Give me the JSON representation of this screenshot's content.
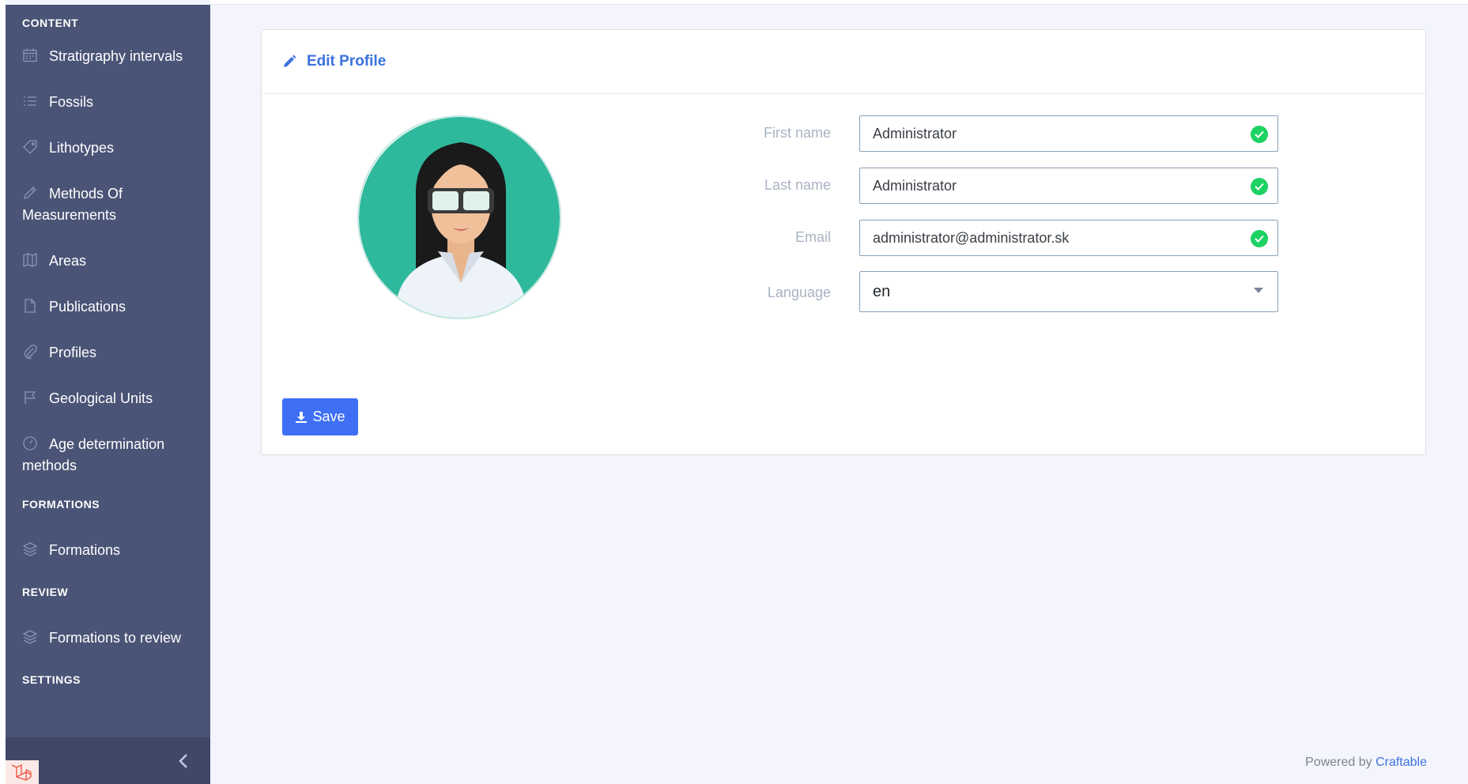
{
  "sidebar": {
    "sections": [
      {
        "title": "CONTENT",
        "items": [
          {
            "label": "Stratigraphy intervals",
            "icon": "calendar-icon"
          },
          {
            "label": "Fossils",
            "icon": "list-icon"
          },
          {
            "label": "Lithotypes",
            "icon": "tag-icon"
          },
          {
            "label": "Methods Of Measurements",
            "icon": "pencil-icon"
          },
          {
            "label": "Areas",
            "icon": "map-icon"
          },
          {
            "label": "Publications",
            "icon": "document-icon"
          },
          {
            "label": "Profiles",
            "icon": "paperclip-icon"
          },
          {
            "label": "Geological Units",
            "icon": "flag-icon"
          },
          {
            "label": "Age determination methods",
            "icon": "speedometer-icon"
          }
        ]
      },
      {
        "title": "FORMATIONS",
        "items": [
          {
            "label": "Formations",
            "icon": "layers-icon"
          }
        ]
      },
      {
        "title": "REVIEW",
        "items": [
          {
            "label": "Formations to review",
            "icon": "layers-icon"
          }
        ]
      },
      {
        "title": "SETTINGS",
        "items": []
      }
    ]
  },
  "card": {
    "title": "Edit Profile"
  },
  "form": {
    "first_name": {
      "label": "First name",
      "value": "Administrator"
    },
    "last_name": {
      "label": "Last name",
      "value": "Administrator"
    },
    "email": {
      "label": "Email",
      "value": "administrator@administrator.sk"
    },
    "language": {
      "label": "Language",
      "value": "en"
    }
  },
  "actions": {
    "save_label": "Save"
  },
  "footer": {
    "powered_by": "Powered by",
    "brand": "Craftable"
  },
  "colors": {
    "sidebar_bg": "#4a5476",
    "accent": "#3b72e0",
    "button": "#3e6ff5",
    "valid": "#1dd263"
  }
}
